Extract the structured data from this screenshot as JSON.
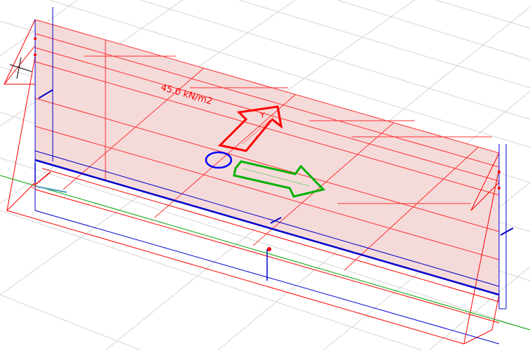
{
  "viewport": {
    "background": "#ffffff",
    "grid_color": "#d0d0d0",
    "load_fill": "#f4d6d6",
    "load_line_color": "#ff0000",
    "member_color": "#0000cc",
    "axis_x_color": "#00a000",
    "axis_y_color": "#ff0000",
    "axis_z_color": "#0000ff"
  },
  "load": {
    "label": "45.0 kN/m2",
    "label_color": "#ff0000"
  },
  "arrows": {
    "red_arrow_icon": "local-y-axis-arrow",
    "red_arrow_label": "Y",
    "green_arrow_icon": "local-x-axis-arrow",
    "blue_circle_icon": "local-z-axis-circle"
  }
}
